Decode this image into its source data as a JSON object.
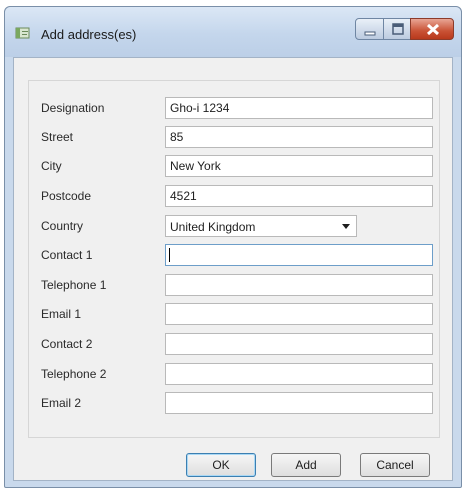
{
  "window": {
    "title": "Add address(es)"
  },
  "form": {
    "fields": [
      {
        "label": "Designation",
        "value": "Gho-i 1234"
      },
      {
        "label": "Street",
        "value": "85"
      },
      {
        "label": "City",
        "value": "New York"
      },
      {
        "label": "Postcode",
        "value": "4521"
      },
      {
        "label": "Country",
        "value": "United Kingdom"
      },
      {
        "label": "Contact 1",
        "value": ""
      },
      {
        "label": "Telephone 1",
        "value": ""
      },
      {
        "label": "Email 1",
        "value": ""
      },
      {
        "label": "Contact 2",
        "value": ""
      },
      {
        "label": "Telephone 2",
        "value": ""
      },
      {
        "label": "Email 2",
        "value": ""
      }
    ]
  },
  "buttons": {
    "ok": "OK",
    "add": "Add",
    "cancel": "Cancel"
  },
  "icons": {
    "app": "address-book-icon",
    "minimize": "minimize-icon",
    "maximize": "maximize-icon",
    "close": "close-icon",
    "dropdown": "chevron-down-icon"
  },
  "colors": {
    "title_bar": "#c4d6ec",
    "close_button": "#c95235",
    "dialog_background": "#f0f0f0",
    "default_button_border": "#3c7fb1"
  }
}
